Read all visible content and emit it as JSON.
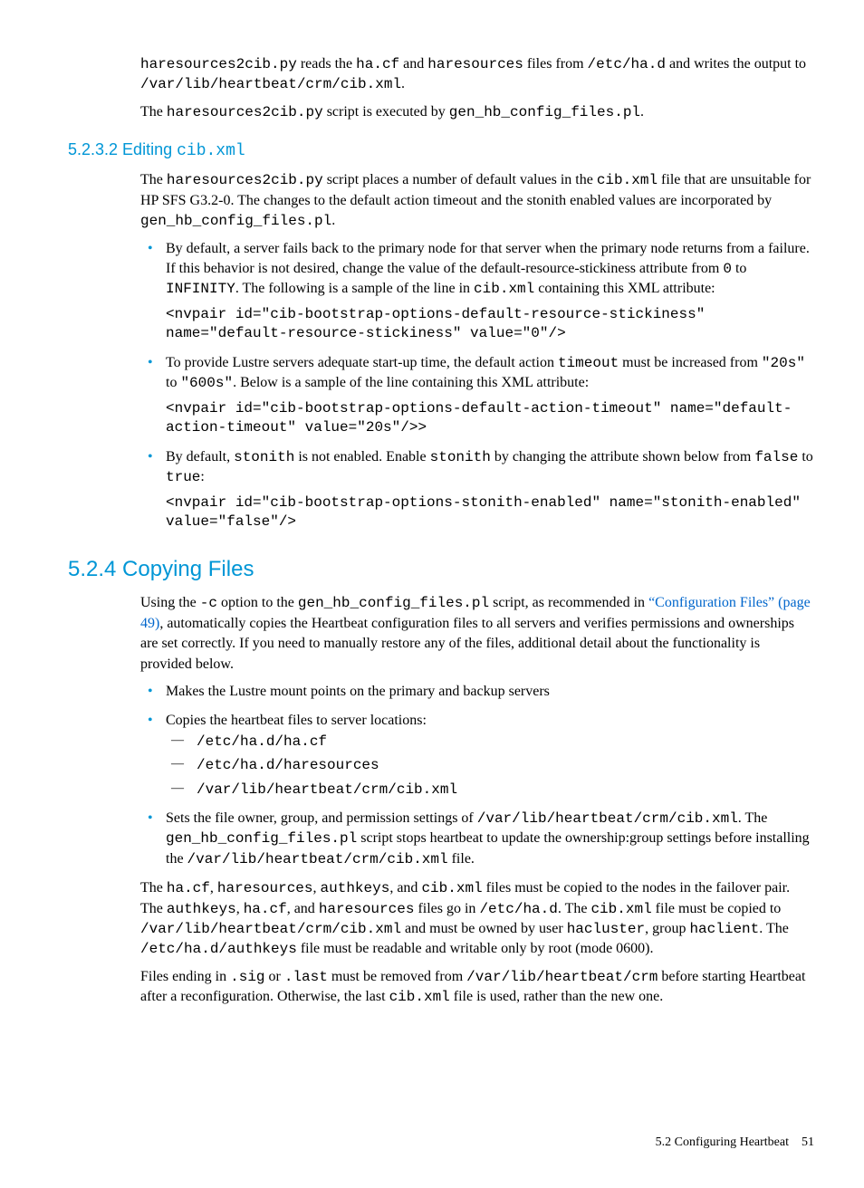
{
  "intro": {
    "p1_a": "haresources2cib.py",
    "p1_b": " reads the ",
    "p1_c": "ha.cf",
    "p1_d": " and ",
    "p1_e": "haresources",
    "p1_f": " files from ",
    "p1_g": "/etc/ha.d",
    "p1_h": " and writes the output to ",
    "p1_i": "/var/lib/heartbeat/crm/cib.xml",
    "p1_j": ".",
    "p2_a": "The ",
    "p2_b": "haresources2cib.py",
    "p2_c": " script is executed by ",
    "p2_d": "gen_hb_config_files.pl",
    "p2_e": "."
  },
  "h5232": {
    "num": "5.2.3.2 ",
    "text": "Editing ",
    "code": "cib.xml"
  },
  "s5232": {
    "p1_a": "The ",
    "p1_b": "haresources2cib.py",
    "p1_c": " script places a number of default values in the ",
    "p1_d": "cib.xml",
    "p1_e": " file that are unsuitable for HP SFS G3.2-0. The changes to the default action timeout and the stonith enabled values are incorporated by ",
    "p1_f": "gen_hb_config_files.pl",
    "p1_g": ".",
    "li1_a": "By default, a server fails back to the primary node for that server when the primary node returns from a failure. If this behavior is not desired, change the value of the default-resource-stickiness attribute from ",
    "li1_b": "0",
    "li1_c": " to ",
    "li1_d": "INFINITY",
    "li1_e": ". The following is a sample of the line in ",
    "li1_f": "cib.xml",
    "li1_g": " containing this XML attribute:",
    "code1": "<nvpair id=\"cib-bootstrap-options-default-resource-stickiness\" name=\"default-resource-stickiness\" value=\"0\"/>",
    "li2_a": "To provide Lustre servers adequate start-up time, the default action ",
    "li2_b": "timeout",
    "li2_c": " must be increased from ",
    "li2_d": "\"20s\"",
    "li2_e": " to ",
    "li2_f": "\"600s\"",
    "li2_g": ". Below is a sample of the line containing this XML attribute:",
    "code2": "<nvpair id=\"cib-bootstrap-options-default-action-timeout\" name=\"default-action-timeout\" value=\"20s\"/>>",
    "li3_a": "By default, ",
    "li3_b": "stonith",
    "li3_c": " is not enabled. Enable ",
    "li3_d": "stonith",
    "li3_e": " by changing the attribute shown below from ",
    "li3_f": "false",
    "li3_g": " to ",
    "li3_h": "true",
    "li3_i": ":",
    "code3": "<nvpair id=\"cib-bootstrap-options-stonith-enabled\" name=\"stonith-enabled\" value=\"false\"/>"
  },
  "h524": {
    "num": "5.2.4 ",
    "text": "Copying Files"
  },
  "s524": {
    "p1_a": "Using the ",
    "p1_b": "-c",
    "p1_c": " option to the ",
    "p1_d": "gen_hb_config_files.pl",
    "p1_e": " script, as recommended in ",
    "p1_link": "“Configuration Files” (page 49)",
    "p1_f": ", automatically copies the Heartbeat configuration files to all servers and verifies permissions and ownerships are set correctly. If you need to manually restore any of the files, additional detail about the functionality is provided below.",
    "li1": "Makes the Lustre mount points on the primary and backup servers",
    "li2": "Copies the heartbeat files to server locations:",
    "sub1": "/etc/ha.d/ha.cf",
    "sub2": "/etc/ha.d/haresources",
    "sub3": "/var/lib/heartbeat/crm/cib.xml",
    "li3_a": "Sets the file owner, group, and permission settings of ",
    "li3_b": "/var/lib/heartbeat/crm/cib.xml",
    "li3_c": ". The ",
    "li3_d": "gen_hb_config_files.pl",
    "li3_e": " script stops heartbeat to update the ownership:group settings before installing the ",
    "li3_f": "/var/lib/heartbeat/crm/cib.xml",
    "li3_g": " file.",
    "p2_a": "The ",
    "p2_b": "ha.cf",
    "p2_c": ", ",
    "p2_d": "haresources",
    "p2_e": ", ",
    "p2_f": "authkeys",
    "p2_g": ", and ",
    "p2_h": "cib.xml",
    "p2_i": " files must be copied to the nodes in the failover pair. The ",
    "p2_j": "authkeys",
    "p2_k": ", ",
    "p2_l": "ha.cf",
    "p2_m": ", and ",
    "p2_n": "haresources",
    "p2_o": " files go in ",
    "p2_p": "/etc/ha.d",
    "p2_q": ". The ",
    "p2_r": "cib.xml",
    "p2_s": " file must be copied to ",
    "p2_t": "/var/lib/heartbeat/crm/cib.xml",
    "p2_u": " and must be owned by user ",
    "p2_v": "hacluster",
    "p2_w": ", group ",
    "p2_x": "haclient",
    "p2_y": ". The ",
    "p2_z": "/etc/ha.d/authkeys",
    "p2_aa": " file must be readable and writable only by root (mode 0600).",
    "p3_a": "Files ending in ",
    "p3_b": ".sig",
    "p3_c": " or ",
    "p3_d": ".last",
    "p3_e": " must be removed from ",
    "p3_f": "/var/lib/heartbeat/crm",
    "p3_g": " before starting Heartbeat after a reconfiguration. Otherwise, the last ",
    "p3_h": "cib.xml",
    "p3_i": " file is used, rather than the new one."
  },
  "footer": {
    "section": "5.2 Configuring Heartbeat",
    "page": "51"
  }
}
